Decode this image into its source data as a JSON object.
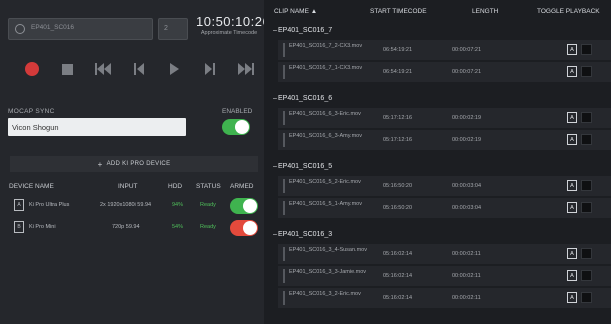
{
  "colors": {
    "record": "#d33a3a",
    "enabled": "#3fb34f",
    "disarmed": "#e34a3c",
    "ready": "#4fbf5a"
  },
  "take": {
    "name": "EP401_SC016",
    "number": "2"
  },
  "timecode": {
    "value": "10:50:10:26",
    "label": "Approximate Timecode"
  },
  "transport": [
    "record-icon",
    "stop-icon",
    "skip-back-icon",
    "step-back-icon",
    "play-icon",
    "step-forward-icon",
    "skip-forward-icon"
  ],
  "mocap": {
    "label": "MOCAP SYNC",
    "enabled_label": "ENABLED",
    "value": "Vicon Shogun",
    "enabled": true
  },
  "add_device_label": "ADD KI PRO DEVICE",
  "devices": {
    "headers": {
      "name": "DEVICE NAME",
      "input": "INPUT",
      "hdd": "HDD",
      "status": "STATUS",
      "armed": "ARMED"
    },
    "rows": [
      {
        "icon": "A",
        "name": "Ki Pro Ultra Plus",
        "input": "2x 1920x1080i 59.94",
        "hdd": "94%",
        "status": "Ready",
        "armed": true
      },
      {
        "icon": "B",
        "name": "Ki Pro Mini",
        "input": "720p 59.94",
        "hdd": "54%",
        "status": "Ready",
        "armed": false
      }
    ]
  },
  "clips": {
    "headers": {
      "name": "CLIP NAME ▲",
      "start": "START TIMECODE",
      "length": "LENGTH",
      "toggle": "TOGGLE PLAYBACK"
    },
    "groups": [
      {
        "name": "EP401_SC016_7",
        "clips": [
          {
            "name": "EP401_SC016_7_2-CX3.mov",
            "start": "06:54:19:21",
            "length": "00:00:07:21",
            "toggle": "A"
          },
          {
            "name": "EP401_SC016_7_1-CX3.mov",
            "start": "06:54:19:21",
            "length": "00:00:07:21",
            "toggle": "A"
          }
        ]
      },
      {
        "name": "EP401_SC016_6",
        "clips": [
          {
            "name": "EP401_SC016_6_3-Eric.mov",
            "start": "05:17:12:16",
            "length": "00:00:02:19",
            "toggle": "A"
          },
          {
            "name": "EP401_SC016_6_3-Amy.mov",
            "start": "05:17:12:16",
            "length": "00:00:02:19",
            "toggle": "A"
          }
        ]
      },
      {
        "name": "EP401_SC016_5",
        "clips": [
          {
            "name": "EP401_SC016_5_2-Eric.mov",
            "start": "05:16:50:20",
            "length": "00:00:03:04",
            "toggle": "A"
          },
          {
            "name": "EP401_SC016_5_1-Amy.mov",
            "start": "05:16:50:20",
            "length": "00:00:03:04",
            "toggle": "A"
          }
        ]
      },
      {
        "name": "EP401_SC016_3",
        "clips": [
          {
            "name": "EP401_SC016_3_4-Susan.mov",
            "start": "05:16:02:14",
            "length": "00:00:02:11",
            "toggle": "A"
          },
          {
            "name": "EP401_SC016_3_3-Jamie.mov",
            "start": "05:16:02:14",
            "length": "00:00:02:11",
            "toggle": "A"
          },
          {
            "name": "EP401_SC016_3_2-Eric.mov",
            "start": "05:16:02:14",
            "length": "00:00:02:11",
            "toggle": "A"
          }
        ]
      }
    ]
  }
}
